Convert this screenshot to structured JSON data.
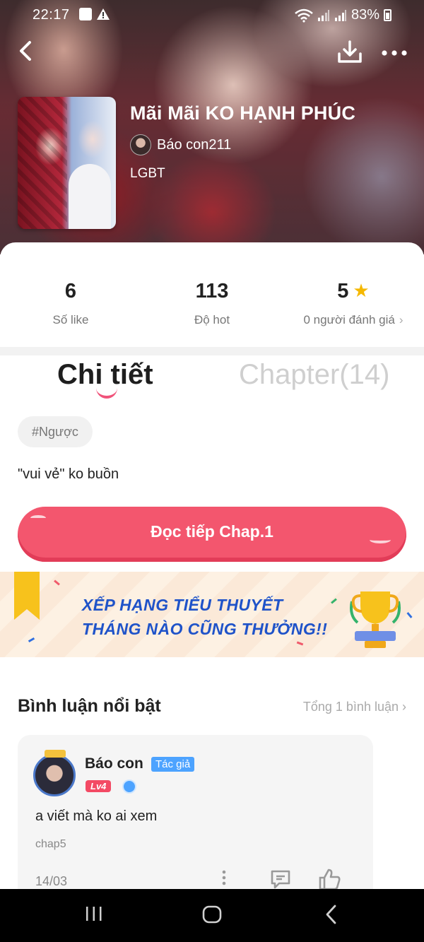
{
  "status_bar": {
    "time": "22:17",
    "battery": "83%"
  },
  "book": {
    "title": "Mãi Mãi KO HẠNH PHÚC",
    "author": "Báo con211",
    "genre": "LGBT"
  },
  "stats": [
    {
      "value": "6",
      "label": "Số like"
    },
    {
      "value": "113",
      "label": "Độ hot"
    },
    {
      "value": "5",
      "label": "0 người đánh giá"
    }
  ],
  "tabs": {
    "detail": "Chi tiết",
    "chapters": "Chapter(14)"
  },
  "tag": "#Ngược",
  "description": "\"vui vẻ\" ko buồn",
  "read_button": "Đọc tiếp Chap.1",
  "banner": {
    "line1": "XẾP HẠNG TIỂU THUYẾT",
    "line2": "THÁNG NÀO CŨNG THƯỞNG!!"
  },
  "comments": {
    "title": "Bình luận nổi bật",
    "total": "Tổng 1 bình luận",
    "items": [
      {
        "name": "Báo con",
        "badge": "Tác giả",
        "level": "Lv4",
        "text": "a viết mà ko ai xem",
        "chapter": "chap5",
        "date": "14/03"
      }
    ]
  },
  "colors": {
    "accent": "#f3566e",
    "badge": "#4da3ff",
    "star": "#f5b800",
    "banner_text": "#1f53c9"
  }
}
